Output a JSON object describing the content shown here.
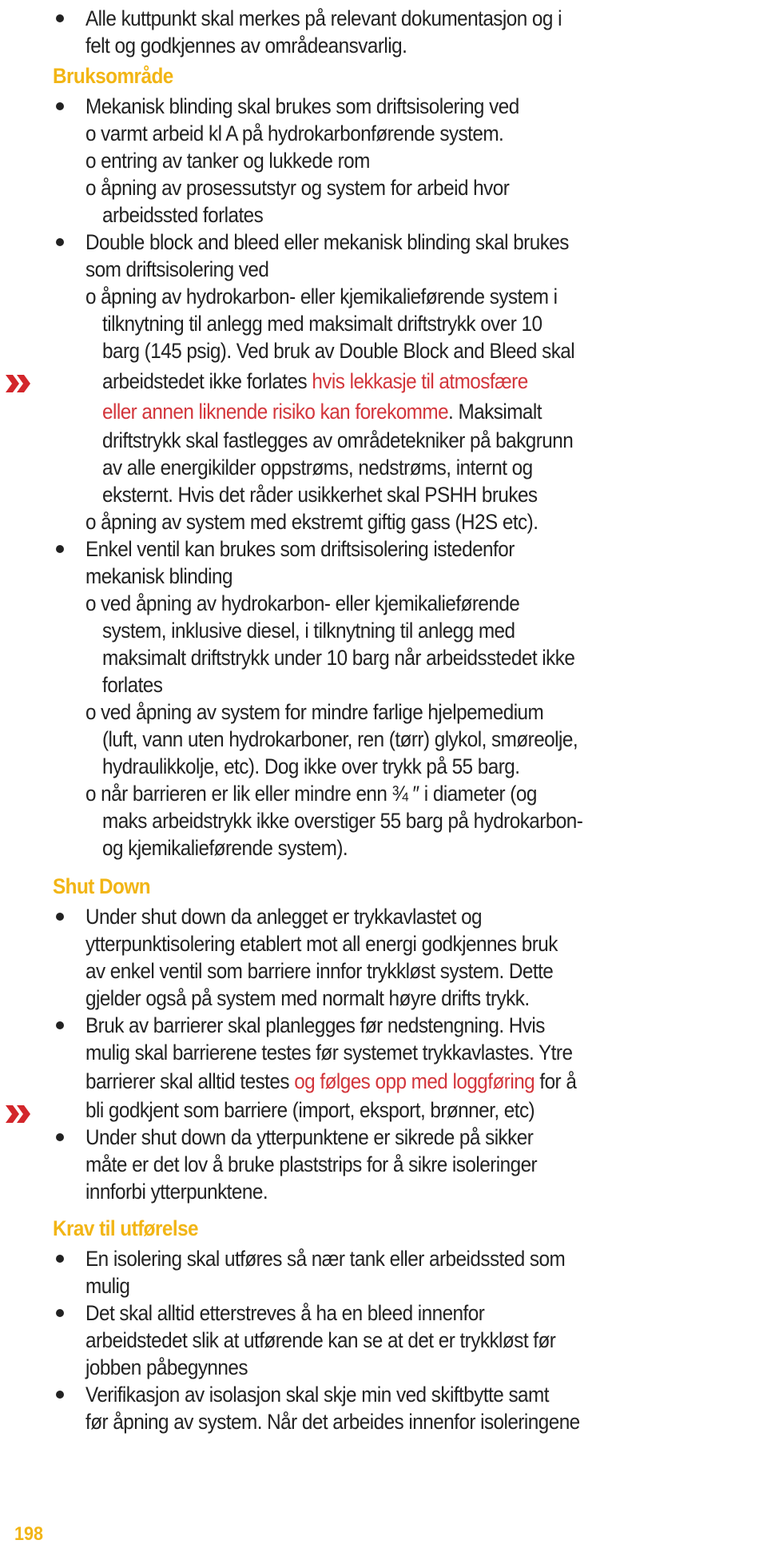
{
  "document": {
    "page_number": "198",
    "colors": {
      "heading": "#f2b515",
      "highlight": "#d3353b",
      "text": "#222222"
    },
    "lines": {
      "l1": "Alle kuttpunkt skal merkes på relevant dokumentasjon og i",
      "l2": "felt og godkjennes av områdeansvarlig.",
      "h1": "Bruksområde",
      "l3": "Mekanisk blinding skal brukes som driftsisolering ved",
      "l4": "o varmt arbeid kl A på hydrokarbonførende system.",
      "l5": "o entring av tanker og lukkede rom",
      "l6": "o åpning av prosessutstyr og system for arbeid hvor",
      "l7": "arbeidssted forlates",
      "l8": "Double block and bleed eller mekanisk blinding skal brukes",
      "l9": "som driftsisolering ved",
      "l10": "o åpning av hydrokarbon- eller kjemikalieførende system i",
      "l11": "tilknytning til anlegg med maksimalt driftstrykk over 10",
      "l12": "barg (145 psig). Ved bruk av Double Block and Bleed skal",
      "l13a": "arbeidstedet ikke forlates ",
      "l13b": "hvis lekkasje til atmosfære",
      "l14a": "eller annen liknende risiko kan forekomme",
      "l14b": ". Maksimalt",
      "l15": "driftstrykk skal fastlegges av områdetekniker på bakgrunn",
      "l16": "av alle energikilder oppstrøms, nedstrøms, internt og",
      "l17": "eksternt. Hvis det råder usikkerhet skal PSHH brukes",
      "l18": "o åpning av system med ekstremt giftig gass (H2S etc).",
      "l19": "Enkel ventil kan brukes som driftsisolering istedenfor",
      "l20": "mekanisk blinding",
      "l21": "o ved åpning av hydrokarbon- eller kjemikalieførende",
      "l22": "system, inklusive diesel, i tilknytning til anlegg med",
      "l23": "maksimalt driftstrykk under 10 barg når arbeidsstedet ikke",
      "l24": "forlates",
      "l25": "o ved åpning av system for mindre farlige hjelpemedium",
      "l26": "(luft, vann uten hydrokarboner, ren (tørr) glykol, smøreolje,",
      "l27": "hydraulikkolje, etc). Dog ikke over trykk på 55 barg.",
      "l28": "o når barrieren er lik eller mindre enn ¾  ″ i diameter (og",
      "l29": "maks arbeidstrykk ikke overstiger 55 barg på hydrokarbon-",
      "l30": "og kjemikalieførende system).",
      "h2": "Shut Down",
      "l31": "Under shut down da anlegget er trykkavlastet og",
      "l32": "ytterpunktisolering etablert mot all energi godkjennes bruk",
      "l33": "av enkel ventil som barriere innfor trykkløst system. Dette",
      "l34": "gjelder også på system med normalt høyre drifts trykk.",
      "l35": "Bruk av barrierer skal planlegges før nedstengning. Hvis",
      "l36": "mulig skal barrierene testes før systemet trykkavlastes. Ytre",
      "l37a": "barrierer skal alltid testes ",
      "l37b": "og følges opp med loggføring",
      "l37c": " for å",
      "l38": "bli godkjent som barriere (import, eksport, brønner, etc)",
      "l39": "Under shut down da ytterpunktene er sikrede på sikker",
      "l40": "måte er det lov å bruke plaststrips for å sikre isoleringer",
      "l41": "innforbi ytterpunktene.",
      "h3": "Krav til utførelse",
      "l42": "En isolering skal utføres så nær tank eller arbeidssted som",
      "l43": "mulig",
      "l44": "Det skal alltid etterstreves å ha en bleed innenfor",
      "l45": "arbeidstedet slik at utførende kan se at det er trykkløst før",
      "l46": "jobben påbegynnes",
      "l47": "Verifikasjon av isolasjon skal skje min  ved skiftbytte samt",
      "l48": "før åpning av system. Når det arbeides innenfor isoleringene"
    }
  }
}
